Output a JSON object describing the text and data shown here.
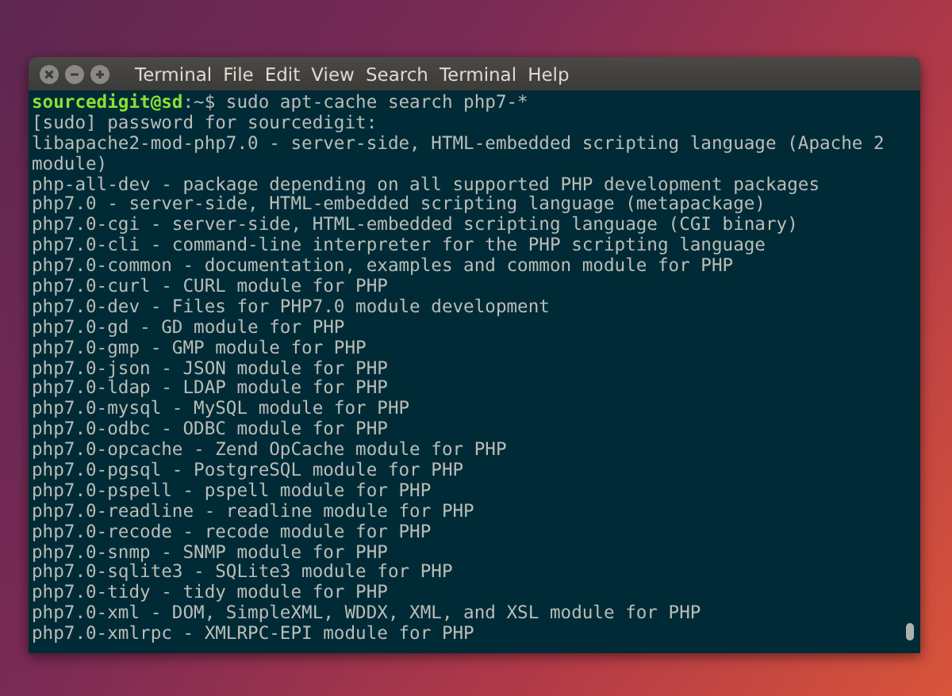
{
  "window": {
    "app_name": "Terminal",
    "menu": [
      "File",
      "Edit",
      "View",
      "Search",
      "Terminal",
      "Help"
    ]
  },
  "terminal": {
    "prompt": {
      "user_host": "sourcedigit@sd",
      "path": ":~$",
      "command": " sudo apt-cache search php7-*"
    },
    "lines": [
      "[sudo] password for sourcedigit:",
      "libapache2-mod-php7.0 - server-side, HTML-embedded scripting language (Apache 2",
      "module)",
      "php-all-dev - package depending on all supported PHP development packages",
      "php7.0 - server-side, HTML-embedded scripting language (metapackage)",
      "php7.0-cgi - server-side, HTML-embedded scripting language (CGI binary)",
      "php7.0-cli - command-line interpreter for the PHP scripting language",
      "php7.0-common - documentation, examples and common module for PHP",
      "php7.0-curl - CURL module for PHP",
      "php7.0-dev - Files for PHP7.0 module development",
      "php7.0-gd - GD module for PHP",
      "php7.0-gmp - GMP module for PHP",
      "php7.0-json - JSON module for PHP",
      "php7.0-ldap - LDAP module for PHP",
      "php7.0-mysql - MySQL module for PHP",
      "php7.0-odbc - ODBC module for PHP",
      "php7.0-opcache - Zend OpCache module for PHP",
      "php7.0-pgsql - PostgreSQL module for PHP",
      "php7.0-pspell - pspell module for PHP",
      "php7.0-readline - readline module for PHP",
      "php7.0-recode - recode module for PHP",
      "php7.0-snmp - SNMP module for PHP",
      "php7.0-sqlite3 - SQLite3 module for PHP",
      "php7.0-tidy - tidy module for PHP",
      "php7.0-xml - DOM, SimpleXML, WDDX, XML, and XSL module for PHP",
      "php7.0-xmlrpc - XMLRPC-EPI module for PHP"
    ]
  }
}
